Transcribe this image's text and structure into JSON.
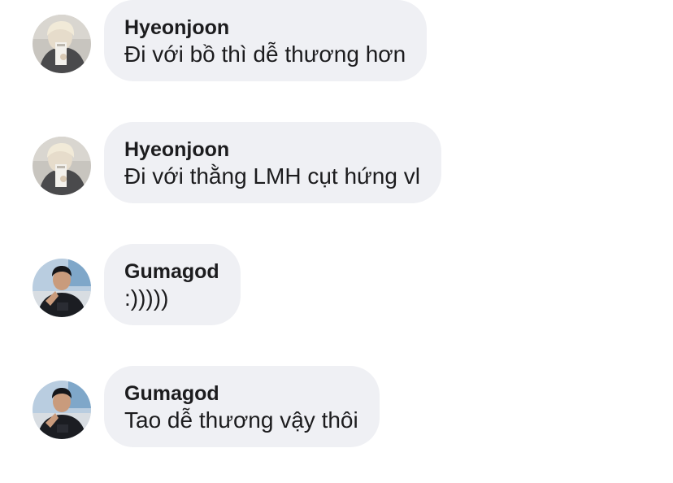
{
  "messages": [
    {
      "sender": "Hyeonjoon",
      "text": "Đi với bồ thì dễ thương hơn"
    },
    {
      "sender": "Hyeonjoon",
      "text": "Đi với thằng LMH cụt hứng vl"
    },
    {
      "sender": "Gumagod",
      "text": ":)))))"
    },
    {
      "sender": "Gumagod",
      "text": "Tao dễ thương vậy thôi"
    }
  ]
}
